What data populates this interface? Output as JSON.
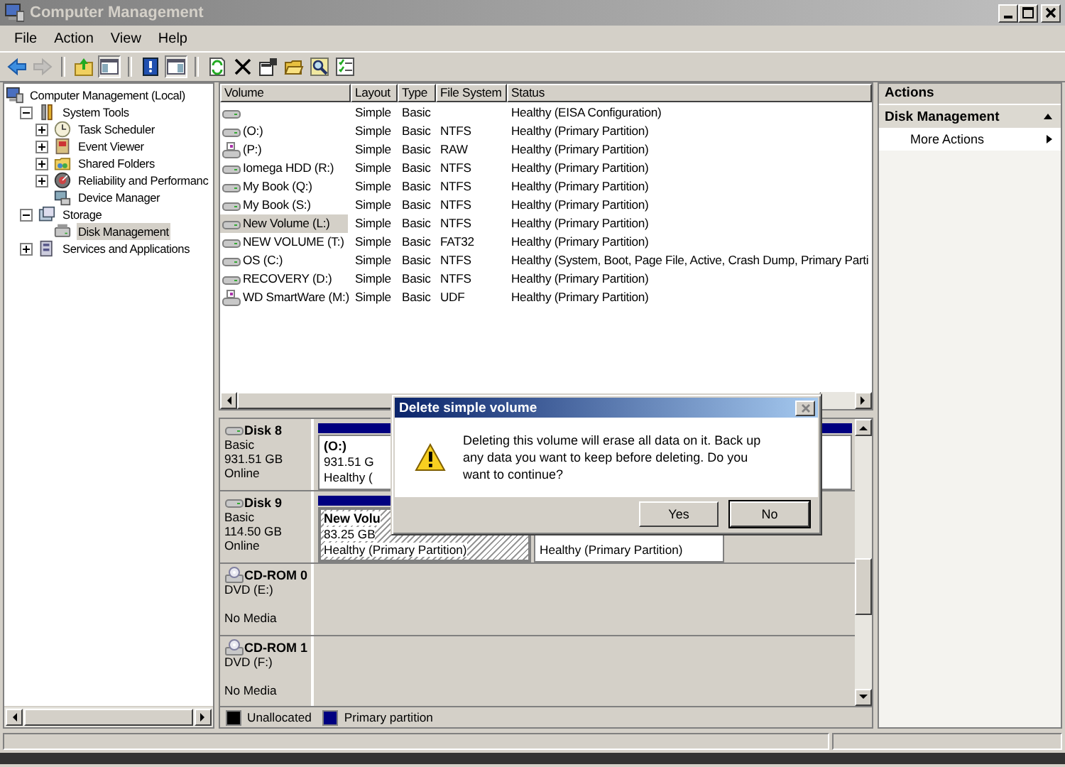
{
  "window": {
    "title": "Computer Management",
    "active": false
  },
  "menu": [
    "File",
    "Action",
    "View",
    "Help"
  ],
  "toolbar": [
    [
      {
        "kind": "back",
        "pressed": false,
        "disabled": false
      },
      {
        "kind": "forward",
        "pressed": false,
        "disabled": true
      }
    ],
    [
      {
        "kind": "up",
        "pressed": false,
        "disabled": false
      },
      {
        "kind": "tree-pane",
        "pressed": true,
        "disabled": false
      }
    ],
    [
      {
        "kind": "help",
        "pressed": false,
        "disabled": false
      },
      {
        "kind": "action-pane",
        "pressed": true,
        "disabled": false
      }
    ],
    [
      {
        "kind": "export",
        "pressed": false,
        "disabled": false
      },
      {
        "kind": "delete",
        "pressed": false,
        "disabled": false
      },
      {
        "kind": "properties",
        "pressed": false,
        "disabled": false
      },
      {
        "kind": "open",
        "pressed": false,
        "disabled": false
      },
      {
        "kind": "search",
        "pressed": false,
        "disabled": false
      },
      {
        "kind": "checklist",
        "pressed": false,
        "disabled": false
      }
    ]
  ],
  "tree": [
    {
      "label": "Computer Management (Local)",
      "selected": false,
      "children": [
        {
          "label": "System Tools",
          "expanded": true,
          "selected": false,
          "children": [
            {
              "label": "Task Scheduler",
              "expanded": false,
              "selected": false
            },
            {
              "label": "Event Viewer",
              "expanded": false,
              "selected": false
            },
            {
              "label": "Shared Folders",
              "expanded": false,
              "selected": false
            },
            {
              "label": "Reliability and Performanc",
              "expanded": false,
              "selected": false
            },
            {
              "label": "Device Manager",
              "selected": false
            }
          ]
        },
        {
          "label": "Storage",
          "expanded": true,
          "selected": false,
          "children": [
            {
              "label": "Disk Management",
              "selected": true
            }
          ]
        },
        {
          "label": "Services and Applications",
          "expanded": false,
          "selected": false
        }
      ]
    }
  ],
  "volumes": {
    "columns": [
      "Volume",
      "Layout",
      "Type",
      "File System",
      "Status"
    ],
    "rows": [
      {
        "kind": "fixed",
        "selected": false,
        "layout": "Simple",
        "type": "Basic",
        "status": "Healthy (EISA Configuration)"
      },
      {
        "kind": "fixed",
        "selected": false,
        "volume": "(O:)",
        "layout": "Simple",
        "type": "Basic",
        "file_system": "NTFS",
        "status": "Healthy (Primary Partition)"
      },
      {
        "kind": "removable",
        "selected": false,
        "volume": "(P:)",
        "layout": "Simple",
        "type": "Basic",
        "file_system": "RAW",
        "status": "Healthy (Primary Partition)"
      },
      {
        "kind": "fixed",
        "selected": false,
        "volume": "Iomega HDD (R:)",
        "layout": "Simple",
        "type": "Basic",
        "file_system": "NTFS",
        "status": "Healthy (Primary Partition)"
      },
      {
        "kind": "fixed",
        "selected": false,
        "volume": "My Book (Q:)",
        "layout": "Simple",
        "type": "Basic",
        "file_system": "NTFS",
        "status": "Healthy (Primary Partition)"
      },
      {
        "kind": "fixed",
        "selected": false,
        "volume": "My Book (S:)",
        "layout": "Simple",
        "type": "Basic",
        "file_system": "NTFS",
        "status": "Healthy (Primary Partition)"
      },
      {
        "kind": "fixed",
        "selected": true,
        "volume": "New Volume (L:)",
        "layout": "Simple",
        "type": "Basic",
        "file_system": "NTFS",
        "status": "Healthy (Primary Partition)"
      },
      {
        "kind": "fixed",
        "selected": false,
        "volume": "NEW VOLUME (T:)",
        "layout": "Simple",
        "type": "Basic",
        "file_system": "FAT32",
        "status": "Healthy (Primary Partition)"
      },
      {
        "kind": "fixed",
        "selected": false,
        "volume": "OS (C:)",
        "layout": "Simple",
        "type": "Basic",
        "file_system": "NTFS",
        "status": "Healthy (System, Boot, Page File, Active, Crash Dump, Primary Parti"
      },
      {
        "kind": "fixed",
        "selected": false,
        "volume": "RECOVERY (D:)",
        "layout": "Simple",
        "type": "Basic",
        "file_system": "NTFS",
        "status": "Healthy (Primary Partition)"
      },
      {
        "kind": "removable",
        "selected": false,
        "volume": "WD SmartWare (M:)",
        "layout": "Simple",
        "type": "Basic",
        "file_system": "UDF",
        "status": "Healthy (Primary Partition)"
      }
    ]
  },
  "disks": [
    {
      "kind": "disk",
      "name": "Disk 8",
      "type": "Basic",
      "size": "931.51 GB",
      "status": "Online",
      "partitions": [
        {
          "selected": false,
          "label": "(O:)",
          "size": "931.51 G",
          "status": "Healthy ("
        }
      ]
    },
    {
      "kind": "disk",
      "name": "Disk 9",
      "type": "Basic",
      "size": "114.50 GB",
      "status": "Online",
      "partitions": [
        {
          "selected": true,
          "label": "New Volu",
          "size": "83.25 GB",
          "status": "Healthy (Primary Partition)"
        },
        {
          "selected": false,
          "status": "Healthy (Primary Partition)"
        }
      ]
    },
    {
      "kind": "cdrom",
      "name": "CD-ROM 0",
      "type": "DVD (E:)",
      "status": "No Media"
    },
    {
      "kind": "cdrom",
      "name": "CD-ROM 1",
      "type": "DVD (F:)",
      "status": "No Media"
    }
  ],
  "legend": [
    {
      "label": "Unallocated",
      "color": "#000000"
    },
    {
      "label": "Primary partition",
      "color": "#000080"
    }
  ],
  "actions": {
    "title": "Actions",
    "sections": [
      {
        "label": "Disk Management",
        "expanded": true,
        "items": [
          "More Actions"
        ]
      }
    ]
  },
  "dialog": {
    "title": "Delete simple volume",
    "message": "Deleting this volume will erase all data on it. Back up any data you want to keep before deleting. Do you want to continue?",
    "buttons": [
      {
        "label": "Yes",
        "default": false
      },
      {
        "label": "No",
        "default": true
      }
    ]
  }
}
